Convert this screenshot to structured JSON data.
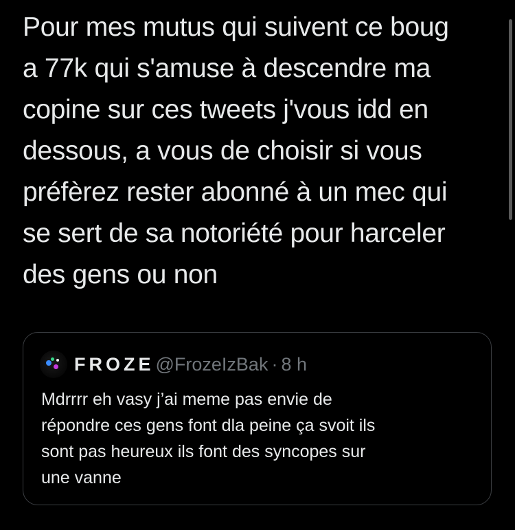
{
  "tweet": {
    "lines": [
      "Pour mes mutus qui suivent ce boug",
      "a 77k qui s'amuse à descendre ma",
      "copine sur ces tweets j'vous idd en",
      "dessous, a vous de choisir si vous",
      "préfèrez rester abonné à un mec qui",
      "se sert de sa notoriété pour harceler",
      "des gens ou non"
    ]
  },
  "quote": {
    "display_name": "FROZE",
    "handle": "@FrozeIzBak",
    "separator": "·",
    "time": "8 h",
    "avatar_icon": "avatar-image",
    "lines": [
      "Mdrrrr eh vasy j’ai meme pas envie de",
      "répondre ces gens font dla peine ça svoit ils",
      "sont pas heureux ils font des syncopes sur",
      "une vanne"
    ]
  },
  "colors": {
    "background": "#000000",
    "text": "#e7e9ea",
    "secondary_text": "#71767b",
    "border": "#3b3e42"
  }
}
